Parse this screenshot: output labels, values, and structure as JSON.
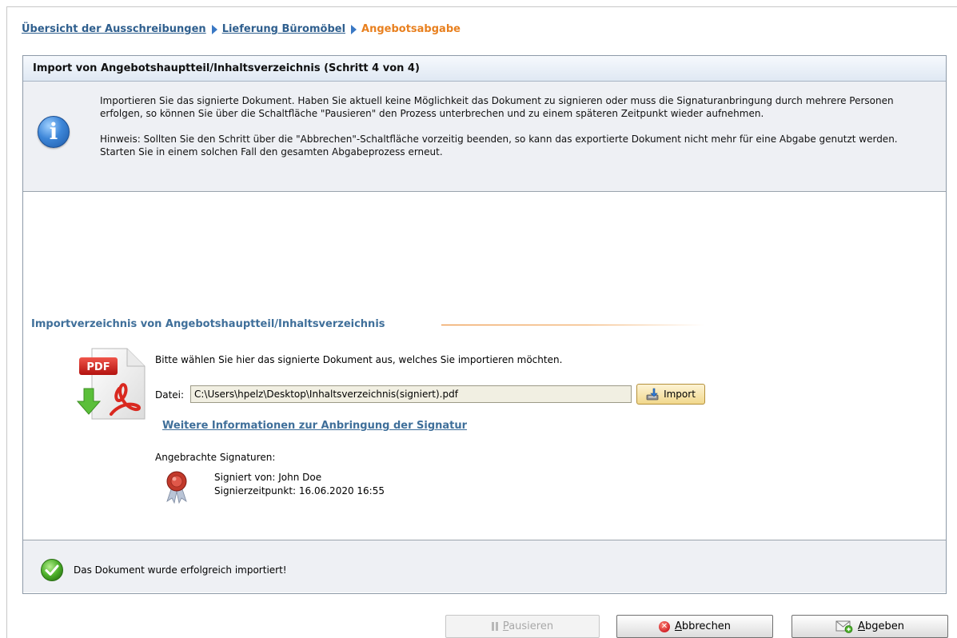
{
  "breadcrumb": {
    "items": [
      {
        "label": "Übersicht der Ausschreibungen"
      },
      {
        "label": "Lieferung Büromöbel"
      }
    ],
    "current": "Angebotsabgabe"
  },
  "panel": {
    "title": "Import von Angebotshauptteil/Inhaltsverzeichnis (Schritt 4 von 4)"
  },
  "info": {
    "icon": "info-icon",
    "paragraph1": "Importieren Sie das signierte Dokument. Haben Sie aktuell keine Möglichkeit das Dokument zu signieren oder muss die Signaturanbringung durch mehrere Personen erfolgen, so können Sie über die Schaltfläche \"Pausieren\" den Prozess unterbrechen und zu einem späteren Zeitpunkt wieder aufnehmen.",
    "paragraph2": "Hinweis: Sollten Sie den Schritt über die \"Abbrechen\"-Schaltfläche vorzeitig beenden, so kann das exportierte Dokument nicht mehr für eine Abgabe genutzt werden. Starten Sie in einem solchen Fall den gesamten Abgabeprozess erneut."
  },
  "import_section": {
    "title": "Importverzeichnis von Angebotshauptteil/Inhaltsverzeichnis",
    "pdf_icon_label": "PDF",
    "instruction": "Bitte wählen Sie hier das signierte Dokument aus, welches Sie importieren möchten.",
    "file_label": "Datei:",
    "file_value": "C:\\Users\\hpelz\\Desktop\\Inhaltsverzeichnis(signiert).pdf",
    "import_button": "Import",
    "more_info_link": "Weitere Informationen zur Anbringung der Signatur"
  },
  "signatures": {
    "label": "Angebrachte Signaturen:",
    "signed_by": "Signiert von: John Doe",
    "signed_at": "Signierzeitpunkt: 16.06.2020 16:55"
  },
  "status": {
    "message": "Das Dokument wurde erfolgreich importiert!"
  },
  "buttons": {
    "pause": {
      "underlined": "P",
      "rest": "ausieren",
      "disabled": true
    },
    "cancel": {
      "underlined": "A",
      "rest": "bbrechen"
    },
    "submit": {
      "underlined": "A",
      "rest": "bgeben"
    }
  },
  "colors": {
    "link": "#2f5f8e",
    "current_crumb": "#e8801f",
    "section_title": "#3f6f9a",
    "panel_header": "#dfe8f3",
    "info_bg": "#eef0f4",
    "success": "#4caf2a",
    "error": "#d2232a"
  }
}
